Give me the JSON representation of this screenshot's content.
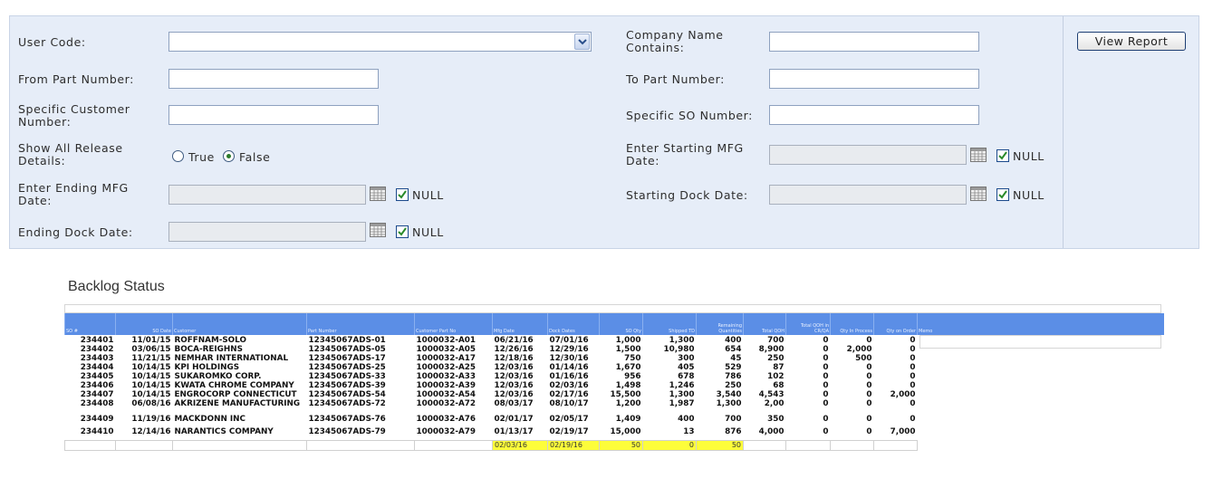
{
  "filters": {
    "user_code": {
      "label": "User Code:",
      "value": ""
    },
    "company_name": {
      "label": "Company Name Contains:",
      "value": ""
    },
    "from_part": {
      "label": "From Part Number:",
      "value": ""
    },
    "to_part": {
      "label": "To Part Number:",
      "value": ""
    },
    "specific_customer": {
      "label": "Specific Customer Number:",
      "value": ""
    },
    "specific_so": {
      "label": "Specific SO Number:",
      "value": ""
    },
    "show_all_release": {
      "label": "Show All Release Details:",
      "true_label": "True",
      "false_label": "False",
      "selected": "False"
    },
    "starting_mfg": {
      "label": "Enter Starting MFG Date:",
      "value": "",
      "null_label": "NULL",
      "null_checked": true
    },
    "ending_mfg": {
      "label": "Enter Ending MFG Date:",
      "value": "",
      "null_label": "NULL",
      "null_checked": true
    },
    "starting_dock": {
      "label": "Starting Dock Date:",
      "value": "",
      "null_label": "NULL",
      "null_checked": true
    },
    "ending_dock": {
      "label": "Ending Dock Date:",
      "value": "",
      "null_label": "NULL",
      "null_checked": true
    },
    "view_report_label": "View Report"
  },
  "report": {
    "title": "Backlog Status",
    "columns": [
      "SO #",
      "SO Date",
      "Customer",
      "Part Number",
      "Customer Part No",
      "Mfg Date",
      "Dock Dates",
      "SO Qty",
      "Shipped TD",
      "Remaining Quantities",
      "Total QOH",
      "Total QOH in CR/QA",
      "Qty In Process",
      "Qty on Order",
      "Memo"
    ],
    "rows": [
      [
        "234401",
        "11/01/15",
        "ROFFNAM-SOLO",
        "12345067ADS-01",
        "1000032-A01",
        "06/21/16",
        "07/01/16",
        "1,000",
        "1,300",
        "400",
        "700",
        "0",
        "0",
        "0"
      ],
      [
        "234402",
        "03/06/15",
        "BOCA-REIGHNS",
        "12345067ADS-05",
        "1000032-A05",
        "12/26/16",
        "12/29/16",
        "1,500",
        "10,980",
        "654",
        "8,900",
        "0",
        "2,000",
        "0"
      ],
      [
        "234403",
        "11/21/15",
        "NEMHAR INTERNATIONAL",
        "12345067ADS-17",
        "1000032-A17",
        "12/18/16",
        "12/30/16",
        "750",
        "300",
        "45",
        "250",
        "0",
        "500",
        "0"
      ],
      [
        "234404",
        "10/14/15",
        "KPI HOLDINGS",
        "12345067ADS-25",
        "1000032-A25",
        "12/03/16",
        "01/14/16",
        "1,670",
        "405",
        "529",
        "87",
        "0",
        "0",
        "0"
      ],
      [
        "234405",
        "10/14/15",
        "SUKAROMKO CORP.",
        "12345067ADS-33",
        "1000032-A33",
        "12/03/16",
        "01/16/16",
        "956",
        "678",
        "786",
        "102",
        "0",
        "0",
        "0"
      ],
      [
        "234406",
        "10/14/15",
        "KWATA CHROME COMPANY",
        "12345067ADS-39",
        "1000032-A39",
        "12/03/16",
        "02/03/16",
        "1,498",
        "1,246",
        "250",
        "68",
        "0",
        "0",
        "0"
      ],
      [
        "234407",
        "10/14/15",
        "ENGROCORP CONNECTICUT",
        "12345067ADS-54",
        "1000032-A54",
        "12/03/16",
        "02/17/16",
        "15,500",
        "1,300",
        "3,540",
        "4,543",
        "0",
        "0",
        "2,000"
      ],
      [
        "234408",
        "06/08/16",
        "AKRIZENE MANUFACTURING",
        "12345067ADS-72",
        "1000032-A72",
        "08/03/17",
        "08/10/17",
        "1,200",
        "1,987",
        "1,300",
        "2,00",
        "0",
        "0",
        "0"
      ],
      [
        "234409",
        "11/19/16",
        "MACKDONN INC",
        "12345067ADS-76",
        "1000032-A76",
        "02/01/17",
        "02/05/17",
        "1,409",
        "400",
        "700",
        "350",
        "0",
        "0",
        "0"
      ],
      [
        "234410",
        "12/14/16",
        "NARANTICS COMPANY",
        "12345067ADS-79",
        "1000032-A79",
        "01/13/17",
        "02/19/17",
        "15,000",
        "13",
        "876",
        "4,000",
        "0",
        "0",
        "7,000"
      ]
    ],
    "totals": {
      "mfg_date": "02/03/16",
      "dock_date": "02/19/16",
      "so_qty": "50",
      "shipped_td": "0",
      "remaining": "50"
    },
    "highlight_color": "#fdfd3a",
    "header_color": "#5b8ee6"
  }
}
